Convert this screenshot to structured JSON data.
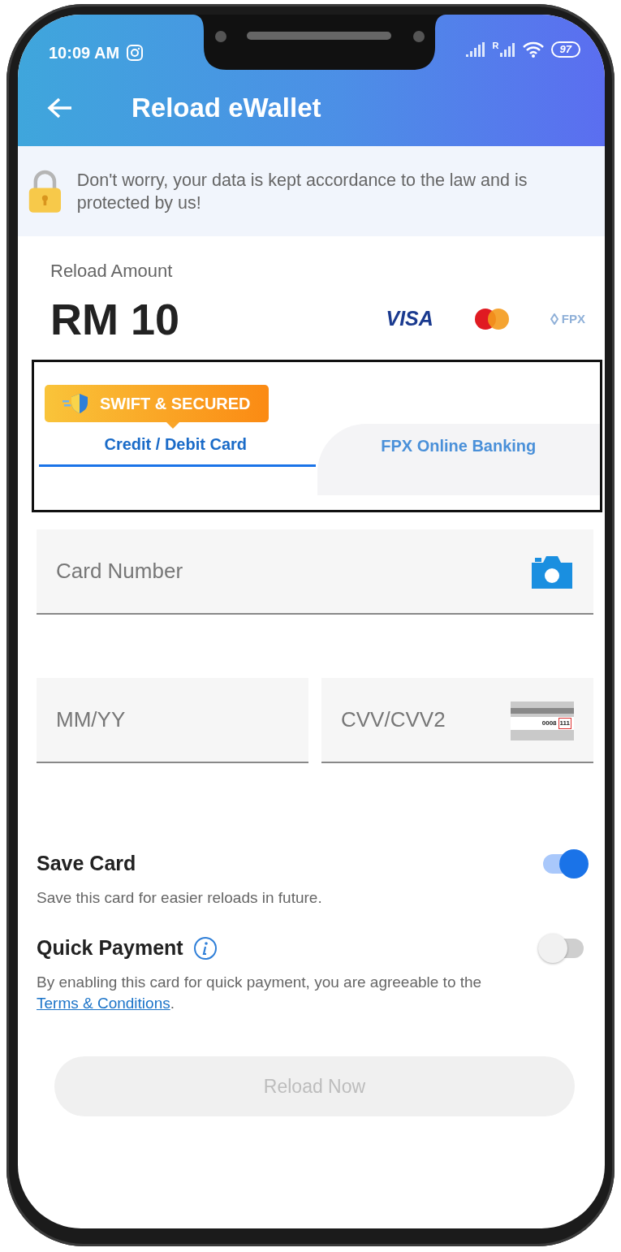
{
  "status_bar": {
    "time": "10:09 AM",
    "roaming_mark": "R",
    "battery": "97"
  },
  "header": {
    "title": "Reload eWallet"
  },
  "notice": {
    "text": "Don't worry, your data is kept accordance to the law and is protected by us!"
  },
  "amount": {
    "label": "Reload Amount",
    "value": "RM 10",
    "payment_logos": [
      {
        "kind": "visa",
        "text": "VISA"
      },
      {
        "kind": "mastercard"
      },
      {
        "kind": "fpx",
        "text": "FPX"
      }
    ]
  },
  "payment_tabs": {
    "badge": "SWIFT & SECURED",
    "tabs": [
      {
        "label": "Credit / Debit Card",
        "selected": true
      },
      {
        "label": "FPX Online Banking",
        "selected": false
      }
    ]
  },
  "card_form": {
    "fields": [
      {
        "kind": "card_number",
        "placeholder": "Card Number"
      },
      {
        "kind": "expiry",
        "placeholder": "MM/YY"
      },
      {
        "kind": "cvv",
        "placeholder": "CVV/CVV2",
        "hint_digits": "0008",
        "hint_code": "111"
      }
    ]
  },
  "options": [
    {
      "title": "Save Card",
      "on": true,
      "info": false,
      "description": "Save this card for easier reloads in future."
    },
    {
      "title": "Quick Payment",
      "on": false,
      "info": true,
      "description": "By enabling this card for quick payment, you are agreeable to the ",
      "link": "Terms & Conditions",
      "after_link": "."
    }
  ],
  "submit": {
    "label": "Reload Now",
    "disabled": true
  }
}
